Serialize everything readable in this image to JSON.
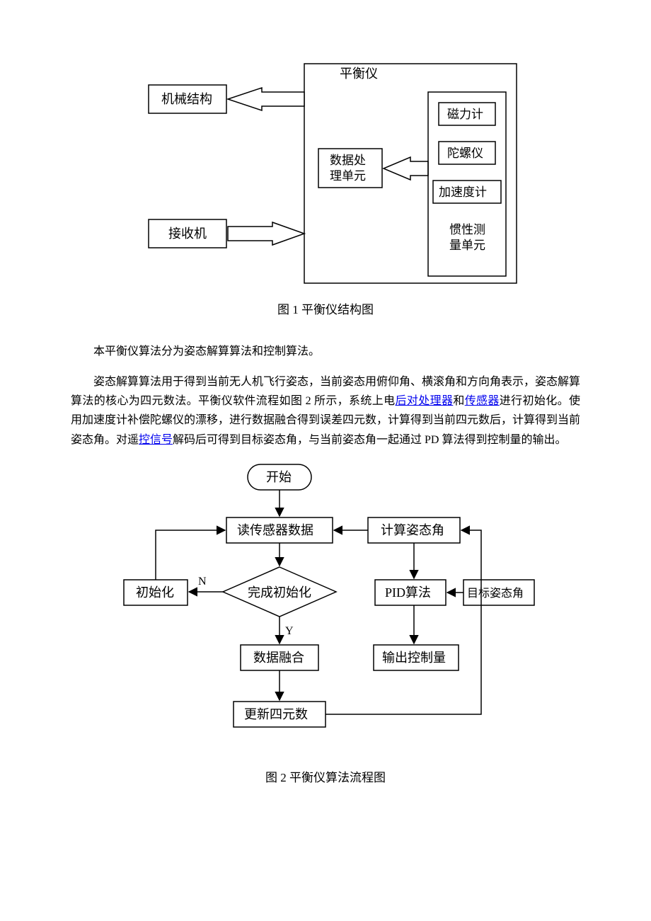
{
  "figure1": {
    "caption": "图 1 平衡仪结构图",
    "nodes": {
      "mechanical": "机械结构",
      "receiver": "接收机",
      "balancer": "平衡仪",
      "dpu1": "数据处",
      "dpu2": "理单元",
      "magnetometer": "磁力计",
      "gyroscope": "陀螺仪",
      "accelerometer": "加速度计",
      "imu1": "惯性测",
      "imu2": "量单元"
    }
  },
  "paragraph1": "本平衡仪算法分为姿态解算算法和控制算法。",
  "paragraph2": {
    "p1": "姿态解算算法用于得到当前无人机飞行姿态，当前姿态用俯仰角、横滚角和方向角表示，姿态解算算法的核心为四元数法。平衡仪软件流程如图 2 所示，系统上电",
    "l1": "后对处理器",
    "p2": "和",
    "l2": "传感器",
    "p3": "进行初始化。使用加速度计补偿陀螺仪的漂移，进行数据融合得到误差四元数，计算得到当前四元数后，计算得到当前姿态角。对遥",
    "l3": "控信号",
    "p4": "解码后可得到目标姿态角，与当前姿态角一起通过 PD 算法得到控制量的输出。"
  },
  "figure2": {
    "caption": "图 2 平衡仪算法流程图",
    "nodes": {
      "start": "开始",
      "read_sensor": "读传感器数据",
      "calc_attitude": "计算姿态角",
      "init": "初始化",
      "init_done": "完成初始化",
      "pid": "PID算法",
      "target": "目标姿态角",
      "fusion": "数据融合",
      "output": "输出控制量",
      "update_q": "更新四元数",
      "N": "N",
      "Y": "Y"
    }
  }
}
